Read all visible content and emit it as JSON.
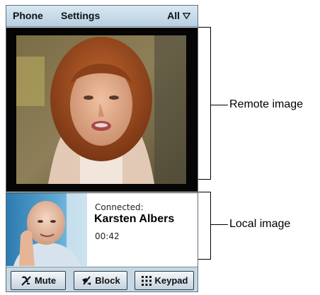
{
  "menu": {
    "phone": "Phone",
    "settings": "Settings",
    "filter": "All",
    "filter_icon": "chevron-down-icon"
  },
  "call": {
    "status": "Connected:",
    "caller_name": "Karsten Albers",
    "duration": "00:42"
  },
  "toolbar": {
    "mute_label": "Mute",
    "mute_icon": "mute-icon",
    "block_label": "Block",
    "block_icon": "block-video-icon",
    "keypad_label": "Keypad",
    "keypad_icon": "keypad-icon"
  },
  "callouts": {
    "remote": "Remote image",
    "local": "Local image"
  },
  "colors": {
    "menubar": "#c6dae9",
    "toolbar": "#c7d8e5",
    "video_border": "#050505"
  }
}
